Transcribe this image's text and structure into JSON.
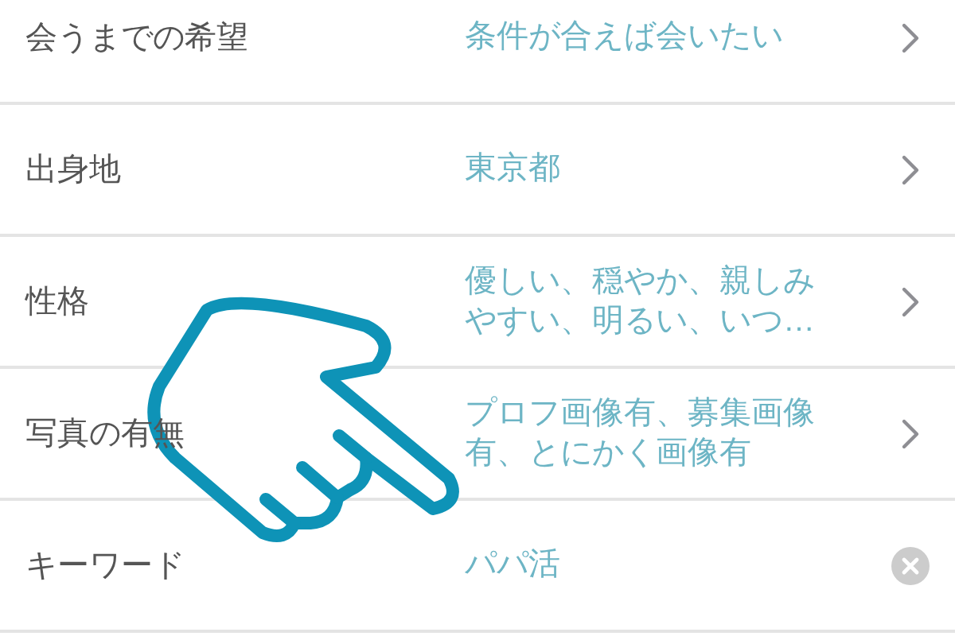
{
  "rows": [
    {
      "label": "会うまでの希望",
      "value": "条件が合えば会いたい",
      "kind": "chevron"
    },
    {
      "label": "出身地",
      "value": "東京都",
      "kind": "chevron"
    },
    {
      "label": "性格",
      "value": "優しい、穏やか、親しみやすい、明るい、いつ…",
      "kind": "chevron"
    },
    {
      "label": "写真の有無",
      "value": "プロフ画像有、募集画像有、とにかく画像有",
      "kind": "chevron"
    },
    {
      "label": "キーワード",
      "value": "パパ活",
      "kind": "clear"
    }
  ]
}
